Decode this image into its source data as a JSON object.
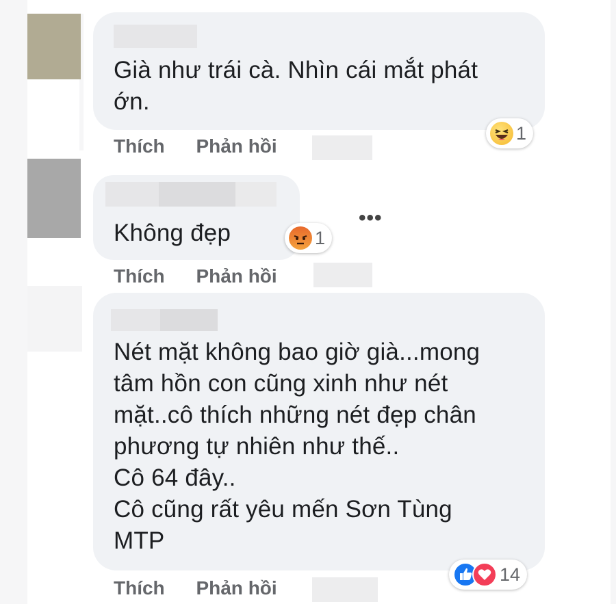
{
  "comments": [
    {
      "text": "Già như trái cà. Nhìn cái mắt phát\nớn.",
      "reaction": {
        "type": "haha",
        "count": "1"
      },
      "like_label": "Thích",
      "reply_label": "Phản hồi"
    },
    {
      "text": "Không đẹp",
      "reaction": {
        "type": "angry",
        "count": "1"
      },
      "like_label": "Thích",
      "reply_label": "Phản hồi",
      "more_label": "•••"
    },
    {
      "text": "Nét mặt không bao giờ già...mong\ntâm hồn con cũng xinh như nét\nmặt..cô thích những nét đẹp chân\nphương tự nhiên như thế..\nCô 64 đây..\nCô cũng rất yêu mến Sơn Tùng\nMTP",
      "reaction": {
        "types": [
          "like",
          "love"
        ],
        "count": "14"
      },
      "like_label": "Thích",
      "reply_label": "Phản hồi"
    }
  ],
  "colors": {
    "bubble": "#f0f2f5",
    "text": "#1c1e21",
    "action": "#65676b",
    "like": "#1877f2",
    "love": "#f33e58",
    "haha": "#f7b928",
    "angry": "#e8692c"
  }
}
